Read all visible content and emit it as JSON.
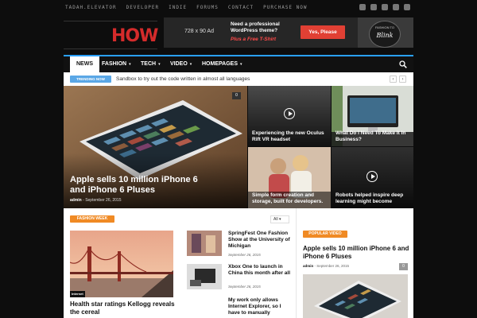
{
  "topbar": {
    "links": [
      "TADAH.ELEVATOR",
      "DEVELOPER",
      "INDIE",
      "FORUMS",
      "CONTACT",
      "PURCHASE NOW"
    ],
    "social_icons": [
      "facebook-icon",
      "twitter-icon",
      "vimeo-icon",
      "youtube-icon",
      "mail-icon"
    ]
  },
  "header": {
    "logo_text": "HOW",
    "ad": {
      "size_label": "728 x 90 Ad",
      "line1": "Need a professional",
      "line2": "WordPress theme?",
      "line3": "Plus a Free T-Shirt",
      "button": "Yes, Please",
      "shirt_text1": "FASHION TO",
      "shirt_text2": "Blink"
    }
  },
  "nav": {
    "items": [
      {
        "label": "NEWS",
        "active": true
      },
      {
        "label": "FASHION",
        "dropdown": true
      },
      {
        "label": "TECH",
        "dropdown": true
      },
      {
        "label": "VIDEO",
        "dropdown": true
      },
      {
        "label": "HOMEPAGES",
        "dropdown": true
      }
    ],
    "caret": "▾"
  },
  "trending": {
    "tag": "TRENDING NOW",
    "text": "Sandbox to try out the code written in almost all languages",
    "prev": "‹",
    "next": "›"
  },
  "featured": {
    "hero": {
      "title": "Apple sells 10 million iPhone 6 and iPhone 6 Pluses",
      "author": "admin",
      "date": "September 26, 2015",
      "comments": "0"
    },
    "tiles": [
      {
        "caption": "Experiencing the new Oculus Rift VR headset",
        "video": true
      },
      {
        "caption": "What Do I Need To Make It In Business?",
        "video": false
      },
      {
        "caption": "Simple form creation and storage, built for developers.",
        "video": false
      },
      {
        "caption": "Robots helped inspire deep learning might become",
        "video": true
      }
    ]
  },
  "fashion_week": {
    "tag": "FASHION WEEK",
    "filter": "All",
    "big": {
      "label": "Internet",
      "title": "Health star ratings Kellogg reveals the cereal"
    },
    "list": [
      {
        "title": "SpringFest One Fashion Show at the University of Michigan",
        "date": "September 26, 2015"
      },
      {
        "title": "Xbox One to launch in China this month after all",
        "date": "September 26, 2015"
      },
      {
        "title": "My work only allows Internet Explorer, so I have to manually",
        "date": ""
      }
    ]
  },
  "popular_video": {
    "tag": "POPULAR VIDEO",
    "title": "Apple sells 10 million iPhone 6 and iPhone 6 Pluses",
    "author": "admin",
    "date": "September 26, 2015",
    "comments": "0"
  },
  "colors": {
    "accent_blue": "#2aa0ff",
    "logo_red": "#d42b2b",
    "tag_orange": "#f08a24",
    "trending_blue": "#5aa7e6",
    "ad_button_red": "#e14034"
  }
}
